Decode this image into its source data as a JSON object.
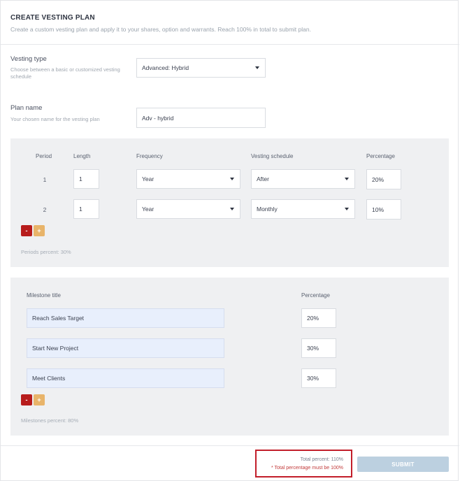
{
  "header": {
    "title": "CREATE VESTING PLAN",
    "subtitle": "Create a custom vesting plan and apply it to your shares, option and warrants. Reach 100% in total to submit plan."
  },
  "vesting_type": {
    "label": "Vesting type",
    "help": "Choose between a basic or customized vesting schedule",
    "value": "Advanced: Hybrid"
  },
  "plan_name": {
    "label": "Plan name",
    "help": "Your chosen name for the vesting plan",
    "value": "Adv - hybrid"
  },
  "periods": {
    "headers": [
      "Period",
      "Length",
      "Frequency",
      "Vesting schedule",
      "Percentage"
    ],
    "rows": [
      {
        "period": "1",
        "length": "1",
        "frequency": "Year",
        "schedule": "After",
        "percentage": "20%"
      },
      {
        "period": "2",
        "length": "1",
        "frequency": "Year",
        "schedule": "Monthly",
        "percentage": "10%"
      }
    ],
    "remove_label": "-",
    "add_label": "+",
    "summary": "Periods percent: 30%"
  },
  "milestones": {
    "headers": [
      "Milestone title",
      "Percentage"
    ],
    "rows": [
      {
        "title": "Reach Sales Target",
        "percentage": "20%"
      },
      {
        "title": "Start New Project",
        "percentage": "30%"
      },
      {
        "title": "Meet Clients",
        "percentage": "30%"
      }
    ],
    "remove_label": "-",
    "add_label": "+",
    "summary": "Milestones percent: 80%"
  },
  "footer": {
    "total": "Total percent: 110%",
    "warning": "* Total percentage must be 100%",
    "submit_label": "SUBMIT"
  },
  "colors": {
    "accent_red": "#b71c1c",
    "accent_orange": "#e8b46a",
    "submit_disabled": "#bcd0e0",
    "panel_bg": "#eff0f2",
    "highlight_border": "#c21e2a"
  }
}
